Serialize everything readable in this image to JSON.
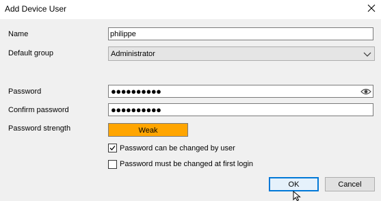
{
  "window": {
    "title": "Add Device User"
  },
  "form": {
    "name_label": "Name",
    "name_value": "philippe",
    "group_label": "Default group",
    "group_value": "Administrator",
    "password_label": "Password",
    "password_value": "●●●●●●●●●●",
    "confirm_label": "Confirm password",
    "confirm_value": "●●●●●●●●●●",
    "strength_label": "Password strength",
    "strength_value": "Weak",
    "strength_color": "#ffa500",
    "cb_change_label": "Password can be changed by user",
    "cb_change_checked": true,
    "cb_first_login_label": "Password must be changed at first login",
    "cb_first_login_checked": false
  },
  "buttons": {
    "ok": "OK",
    "cancel": "Cancel"
  },
  "icons": [
    "close-icon",
    "chevron-down-icon",
    "eye-icon",
    "checkmark-icon",
    "mouse-cursor-icon"
  ]
}
